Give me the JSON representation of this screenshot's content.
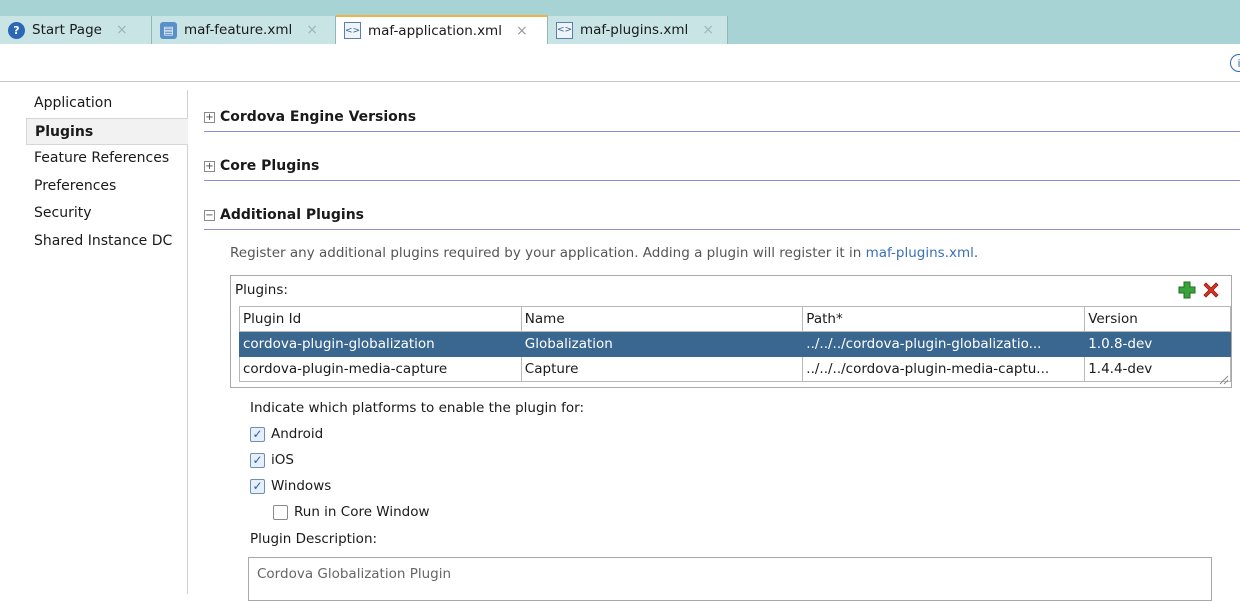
{
  "tabs": [
    {
      "label": "Start Page",
      "icon": "help-icon"
    },
    {
      "label": "maf-feature.xml",
      "icon": "feature-file-icon"
    },
    {
      "label": "maf-application.xml",
      "icon": "xml-file-icon",
      "active": true
    },
    {
      "label": "maf-plugins.xml",
      "icon": "xml-file-icon"
    }
  ],
  "nav": {
    "items": [
      "Application",
      "Plugins",
      "Feature References",
      "Preferences",
      "Security",
      "Shared Instance DC"
    ],
    "selected": "Plugins"
  },
  "sections": {
    "engine": "Cordova Engine Versions",
    "core": "Core Plugins",
    "additional": "Additional Plugins"
  },
  "description": {
    "text": "Register any additional plugins required by your application. Adding a plugin will register it in ",
    "link": "maf-plugins.xml",
    "end": "."
  },
  "plugins": {
    "label": "Plugins:",
    "columns": [
      "Plugin Id",
      "Name",
      "Path*",
      "Version"
    ],
    "rows": [
      [
        "cordova-plugin-globalization",
        "Globalization",
        "../../../cordova-plugin-globalizatio...",
        "1.0.8-dev"
      ],
      [
        "cordova-plugin-media-capture",
        "Capture",
        "../../../cordova-plugin-media-captu...",
        "1.4.4-dev"
      ]
    ]
  },
  "platforms": {
    "prompt": "Indicate which platforms to enable the plugin for:",
    "android": "Android",
    "ios": "iOS",
    "windows": "Windows",
    "core_window": "Run in Core Window"
  },
  "plugin_description": {
    "label": "Plugin Description:",
    "value": "Cordova Globalization Plugin"
  },
  "colors": {
    "tabbar": "#a8d3d4",
    "selected_row": "#3a6790",
    "section_rule": "#8f8fcf",
    "link": "#3a6fb8"
  }
}
